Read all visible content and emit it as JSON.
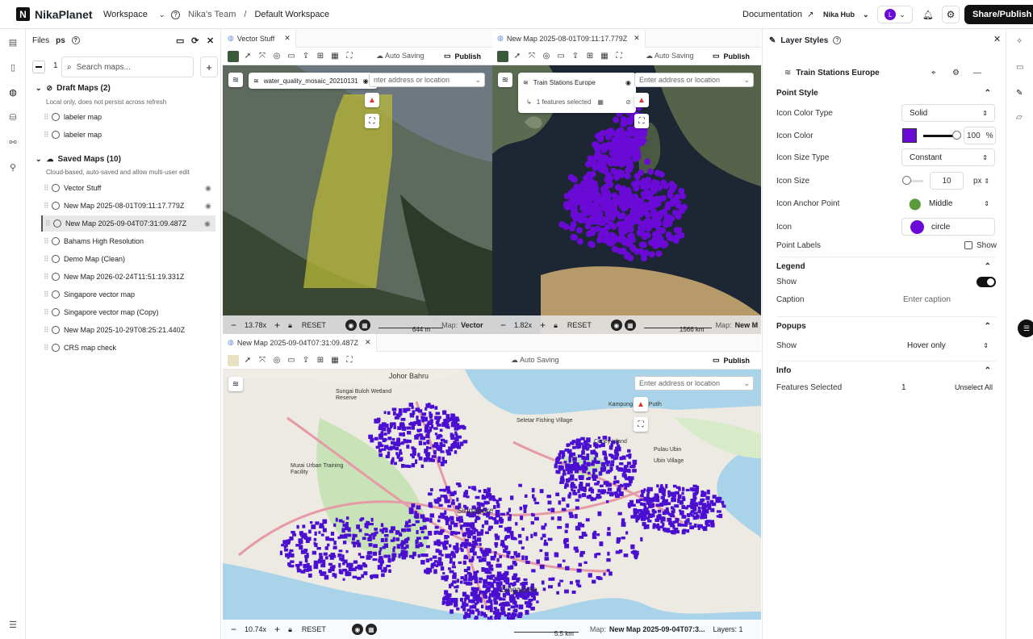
{
  "app": {
    "logo_letter": "N",
    "name": "NikaPlanet"
  },
  "topbar": {
    "workspace_label": "Workspace",
    "team": "Nika's Team",
    "separator": "/",
    "current_workspace": "Default Workspace",
    "documentation": "Documentation",
    "hub": "Nika Hub",
    "avatar_letter": "L",
    "share_publish": "Share/Publish"
  },
  "sidebar": {
    "files_label": "Files",
    "maps_label": "ps",
    "count_label": "1",
    "search_placeholder": "Search maps...",
    "draft": {
      "title": "Draft Maps (2)",
      "subtitle": "Local only, does not persist across refresh",
      "items": [
        "labeler map",
        "labeler map"
      ]
    },
    "saved": {
      "title": "Saved Maps (10)",
      "subtitle": "Cloud-based, auto-saved and allow multi-user edit",
      "items": [
        "Vector Stuff",
        "New Map 2025-08-01T09:11:17.779Z",
        "New Map 2025-09-04T07:31:09.487Z",
        "Bahams High Resolution",
        "Demo Map (Clean)",
        "New Map 2026-02-24T11:51:19.331Z",
        "Singapore vector map",
        "Singapore vector map (Copy)",
        "New Map 2025-10-29T08:25:21.440Z",
        "CRS map check"
      ]
    }
  },
  "pane1": {
    "tab": "Vector Stuff",
    "auto_saving": "Auto Saving",
    "publish": "Publish",
    "layer": "water_quality_mosaic_20210131",
    "address_placeholder": "nter address or location",
    "zoom": "13.78x",
    "reset": "RESET",
    "scale": "644 m",
    "map_label": "Map:",
    "map_name": "Vector"
  },
  "pane2": {
    "tab": "New Map 2025-08-01T09:11:17.779Z",
    "auto_saving": "Auto Saving",
    "publish": "Publish",
    "layer": "Train Stations Europe",
    "selected": "1 features selected",
    "address_placeholder": "Enter address or location",
    "zoom": "1.82x",
    "reset": "RESET",
    "scale": "1566 km",
    "map_label": "Map:",
    "map_name": "New M"
  },
  "pane3": {
    "tab": "New Map 2025-09-04T07:31:09.487Z",
    "auto_saving": "Auto Saving",
    "publish": "Publish",
    "address_placeholder": "Enter address or location",
    "zoom": "10.74x",
    "reset": "RESET",
    "scale": "5.5 km",
    "map_label": "Map:",
    "map_name": "New Map 2025-09-04T07:3...",
    "layers_label": "Layers: 1",
    "places": [
      "Johor Bahru",
      "Sungai Buloh Wetland Reserve",
      "Seletar Fishing Village",
      "Coney Island",
      "Pulau Ubin",
      "Ubin Village",
      "Kampung Pasir Putih",
      "Murai Urban Training Facility",
      "Singapore",
      "Singapore"
    ]
  },
  "layer_styles": {
    "title": "Layer Styles",
    "layer_name": "Train Stations Europe",
    "point_style": "Point Style",
    "icon_color_type_label": "Icon Color Type",
    "icon_color_type": "Solid",
    "icon_color_label": "Icon Color",
    "icon_color": "#6b0ad6",
    "opacity": "100",
    "opacity_unit": "%",
    "icon_size_type_label": "Icon Size Type",
    "icon_size_type": "Constant",
    "icon_size_label": "Icon Size",
    "icon_size": "10",
    "icon_size_unit": "px",
    "anchor_label": "Icon Anchor Point",
    "anchor": "Middle",
    "icon_label": "Icon",
    "icon": "circle",
    "point_labels_label": "Point Labels",
    "point_labels_show": "Show",
    "legend": "Legend",
    "legend_show_label": "Show",
    "caption_label": "Caption",
    "caption_placeholder": "Enter caption",
    "popups": "Popups",
    "popups_show_label": "Show",
    "popups_show": "Hover only",
    "info": "Info",
    "features_selected_label": "Features Selected",
    "features_selected": "1",
    "unselect_all": "Unselect All"
  },
  "colors": {
    "accent": "#6b0ad6",
    "points": "#4a0fd0"
  }
}
